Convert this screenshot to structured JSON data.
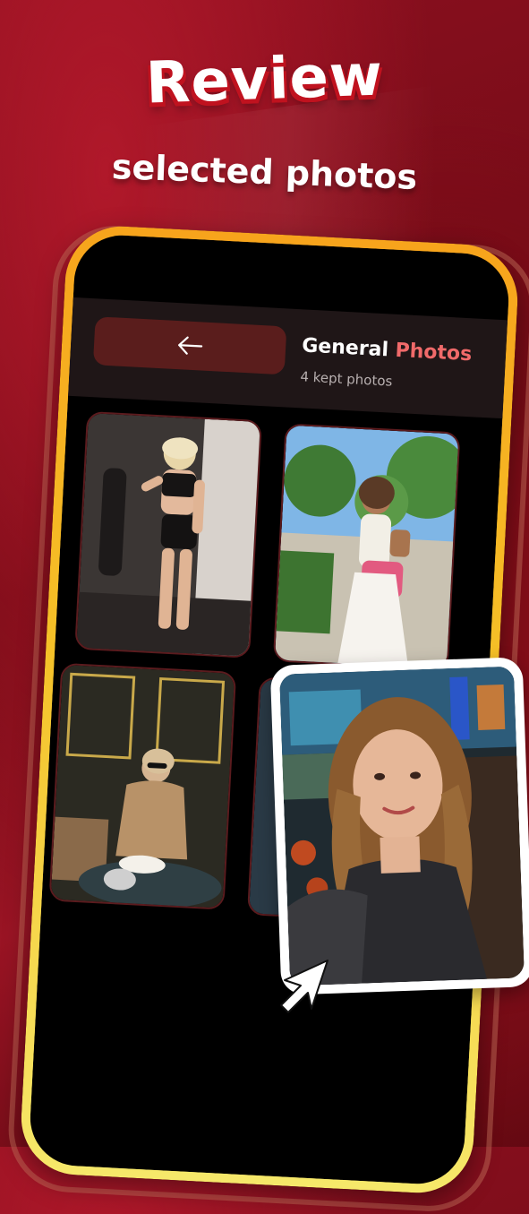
{
  "promo": {
    "headline": "Review",
    "subheadline": "selected photos"
  },
  "screen": {
    "back_icon": "arrow-left-icon",
    "title_part1": "General",
    "title_part2": "Photos",
    "subtitle": "4 kept photos"
  },
  "photos": [
    {
      "kind": "gym-portrait"
    },
    {
      "kind": "outdoor-park-portrait"
    },
    {
      "kind": "cafe-portrait"
    },
    {
      "kind": "selfie-portrait"
    }
  ],
  "colors": {
    "background": "#8d1020",
    "frame_gold": "#f6c02a",
    "accent_pink": "#f06a6a",
    "header_bg": "#1f1617",
    "back_button_bg": "#5a1d1c"
  }
}
